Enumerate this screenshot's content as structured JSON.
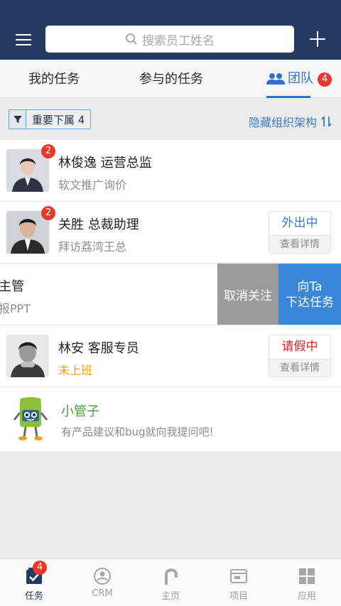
{
  "header": {
    "search_placeholder": "搜索员工姓名"
  },
  "tabs": [
    {
      "label": "我的任务"
    },
    {
      "label": "参与的任务"
    },
    {
      "label": "团队",
      "badge": "4"
    }
  ],
  "filter": {
    "chip_label": "重要下属 4",
    "hide_org_label": "隐藏组织架构"
  },
  "rows": [
    {
      "name": "林俊逸 运营总监",
      "sub": "软文推广询价",
      "badge": "2"
    },
    {
      "name": "关胜 总裁助理",
      "sub": "拜访荔湾王总",
      "badge": "2",
      "status": "外出中",
      "detail": "查看详情"
    },
    {
      "name": "主管",
      "sub": "报PPT",
      "action_unfollow": "取消关注",
      "action_assign_1": "向Ta",
      "action_assign_2": "下达任务"
    },
    {
      "name": "林安 客服专员",
      "sub": "未上班",
      "status": "请假中",
      "detail": "查看详情"
    },
    {
      "name": "小管子",
      "sub": "有产品建议和bug就向我提问吧!"
    }
  ],
  "tabbar": [
    {
      "label": "任务",
      "badge": "4",
      "icon": "task-icon"
    },
    {
      "label": "CRM",
      "icon": "crm-icon"
    },
    {
      "label": "主页",
      "icon": "home-icon"
    },
    {
      "label": "项目",
      "icon": "project-icon"
    },
    {
      "label": "应用",
      "icon": "apps-icon"
    }
  ],
  "colors": {
    "header": "#243a5e",
    "accent": "#3073c5",
    "badge": "#e8392c",
    "assign": "#3a86d8",
    "unfollow": "#9b9b9b"
  }
}
